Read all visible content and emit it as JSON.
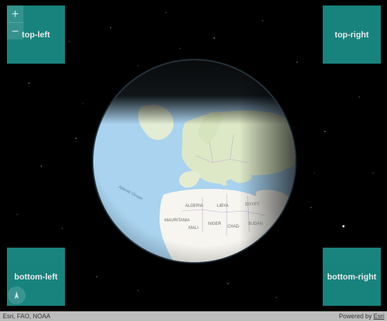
{
  "map": {
    "corners": {
      "top_left": "top-left",
      "top_right": "top-right",
      "bottom_left": "bottom-left",
      "bottom_right": "bottom-right"
    },
    "zoom": {
      "in_label": "+",
      "out_label": "−"
    },
    "globe_labels": {
      "atlantic": "Atlantic Ocean",
      "algeria": "ALGERIA",
      "egypt": "EGYPT",
      "libya": "LIBYA",
      "chad": "CHAD",
      "niger": "NIGER",
      "mali": "MALI",
      "sudan": "SUDAN",
      "mauritania": "MAURITANIA"
    }
  },
  "attribution": {
    "sources": "Esri, FAO, NOAA",
    "powered_prefix": "Powered by ",
    "powered_link": "Esri"
  },
  "colors": {
    "panel": "#1b8f88",
    "ocean": "#a9d3ef",
    "land": "#dde8c7",
    "desert": "#f6f5ef",
    "attribution_bar": "#bdbdbd"
  }
}
